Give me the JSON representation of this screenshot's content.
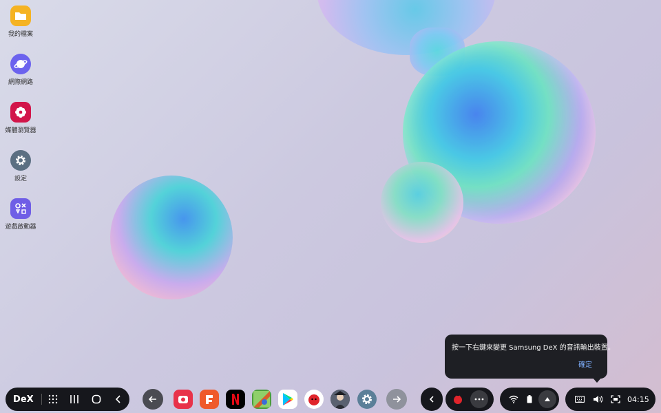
{
  "desktop": {
    "icons": [
      {
        "label": "我的檔案",
        "color": "#f5b323",
        "icon": "folder-icon"
      },
      {
        "label": "網際網路",
        "color": "#6c63ee",
        "icon": "planet-icon"
      },
      {
        "label": "媒體瀏覽器",
        "color": "#d2154a",
        "icon": "flower-icon"
      },
      {
        "label": "設定",
        "color": "#5b6f82",
        "icon": "gear-icon"
      },
      {
        "label": "遊戲啟動器",
        "color": "#6f5ee6",
        "icon": "game-launcher-icon"
      }
    ]
  },
  "taskbar": {
    "dex_label": "DeX",
    "clock": "04:15",
    "accent": "#3a3b40"
  },
  "tooltip": {
    "message": "按一下右鍵來變更 Samsung DeX 的音訊輸出裝置。",
    "ok_label": "確定"
  },
  "apps": [
    {
      "name": "camera-app-icon",
      "color": "#e8324a"
    },
    {
      "name": "office-app-icon",
      "color": "#ef5a2b"
    },
    {
      "name": "netflix-app-icon",
      "color": "#000000"
    },
    {
      "name": "game-app-icon",
      "color": "#4a9c3b"
    },
    {
      "name": "play-store-app-icon",
      "color": "#ffffff"
    },
    {
      "name": "antutu-app-icon",
      "color": "#ffffff"
    },
    {
      "name": "character-app-icon",
      "color": "#3b3f48"
    },
    {
      "name": "settings-app-icon",
      "color": "#5b7f98"
    }
  ]
}
